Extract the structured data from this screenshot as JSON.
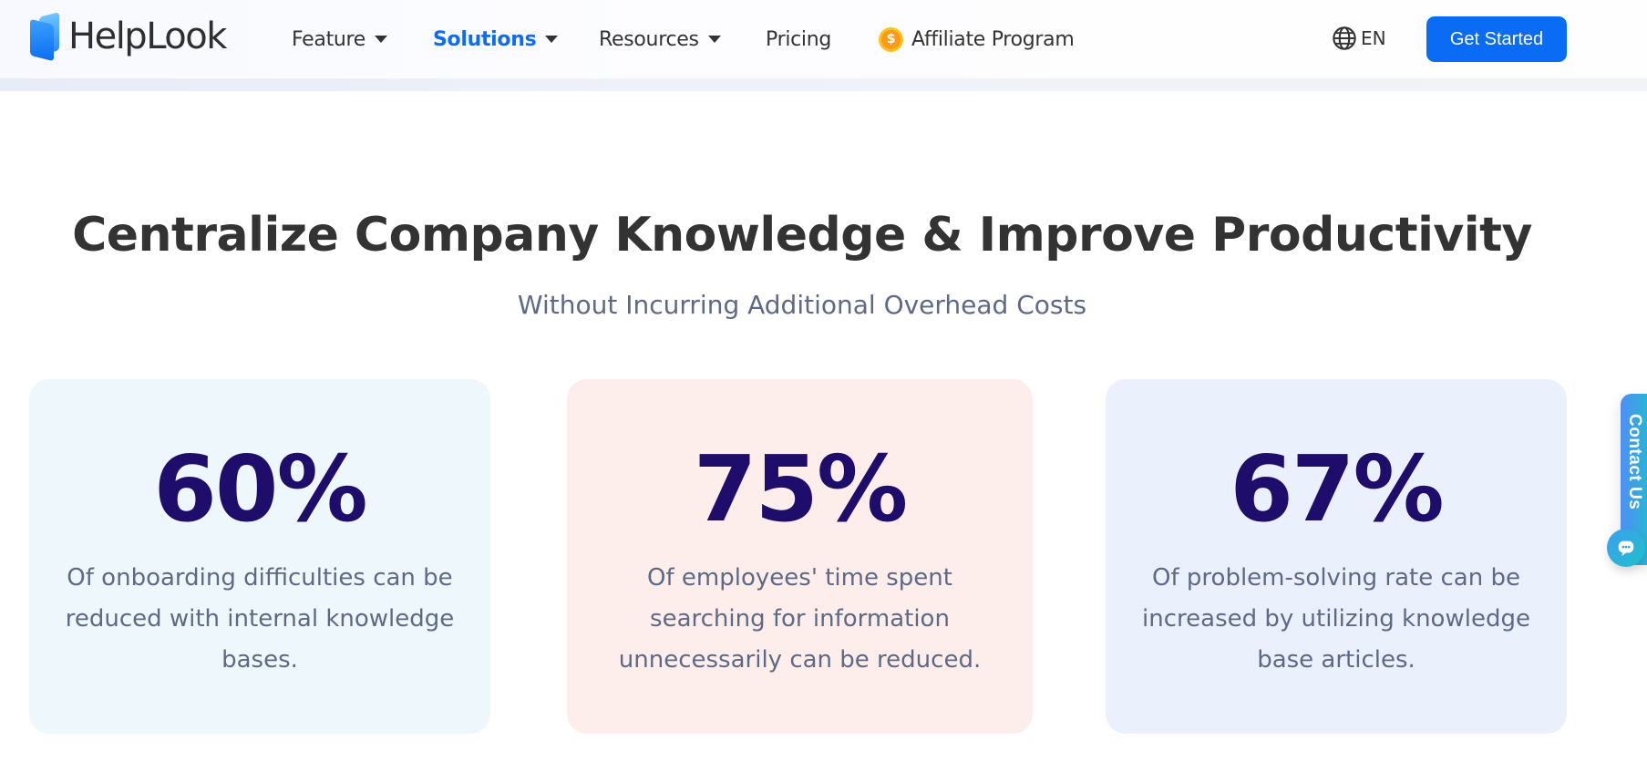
{
  "brand": {
    "name": "HelpLook",
    "logo_icon": "helplook-logo-icon"
  },
  "nav": {
    "items": [
      {
        "label": "Feature",
        "has_dropdown": true,
        "active": false
      },
      {
        "label": "Solutions",
        "has_dropdown": true,
        "active": true
      },
      {
        "label": "Resources",
        "has_dropdown": true,
        "active": false
      },
      {
        "label": "Pricing",
        "has_dropdown": false,
        "active": false
      },
      {
        "label": "Affiliate Program",
        "has_dropdown": false,
        "active": false,
        "icon": "dollar-coin-icon",
        "icon_glyph": "$"
      }
    ],
    "language": {
      "label": "EN",
      "icon": "globe-icon"
    },
    "cta_label": "Get Started",
    "accent_color": "#0a6cf5"
  },
  "hero": {
    "title": "Centralize Company Knowledge & Improve Productivity",
    "subtitle": "Without Incurring Additional Overhead Costs"
  },
  "stats": [
    {
      "value": "60%",
      "description": "Of onboarding difficulties can be reduced with internal knowledge bases.",
      "bg_color": "#eef7fb"
    },
    {
      "value": "75%",
      "description": "Of employees' time spent searching for information unnecessarily can be reduced.",
      "bg_color": "#fdeeec"
    },
    {
      "value": "67%",
      "description": "Of problem-solving rate can be increased by utilizing knowledge base articles.",
      "bg_color": "#eaf1fd"
    }
  ],
  "contact_widget": {
    "label": "Contact Us",
    "icon": "chat-bubble-icon"
  }
}
